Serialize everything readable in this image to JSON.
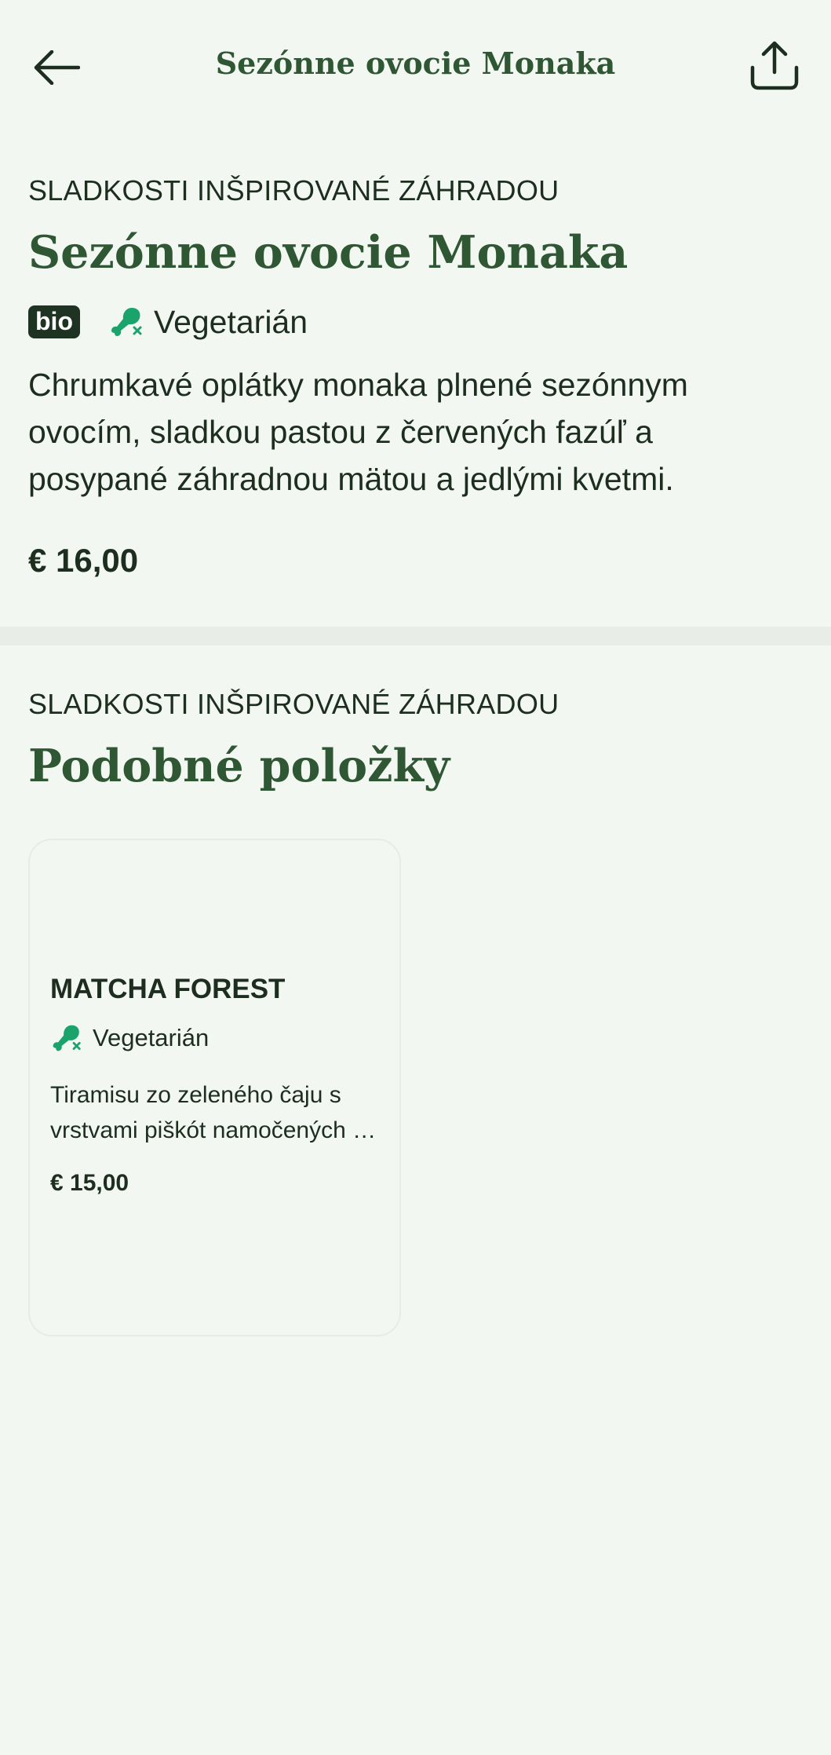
{
  "header": {
    "title": "Sezónne ovocie Monaka",
    "back_icon": "arrow-left-icon",
    "share_icon": "share-icon"
  },
  "item": {
    "category": "SLADKOSTI INŠPIROVANÉ ZÁHRADOU",
    "name": "Sezónne ovocie Monaka",
    "badge": "bio",
    "diet_icon": "drumstick-crossed-icon",
    "diet_label": "Vegetarián",
    "description": "Chrumkavé oplátky monaka plnené sezónnym ovocím, sladkou pastou z červených fazúľ a posypané záhradnou mätou a jedlými kvetmi.",
    "price": "€ 16,00"
  },
  "similar": {
    "category": "SLADKOSTI INŠPIROVANÉ ZÁHRADOU",
    "title": "Podobné položky",
    "items": [
      {
        "name": "MATCHA FOREST",
        "diet_label": "Vegetarián",
        "description": "Tiramisu zo zeleného čaju s vrstvami piškót namočených v matcha",
        "price": "€ 15,00"
      }
    ]
  },
  "colors": {
    "background": "#f3f7f2",
    "accent_green": "#2f5734",
    "icon_green": "#1aa36b",
    "text_dark": "#1d2e1f",
    "badge_bg": "#1e3322"
  }
}
